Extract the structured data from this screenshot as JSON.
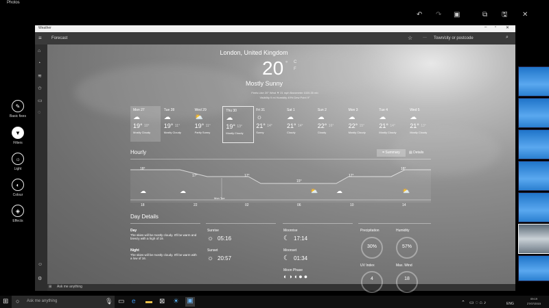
{
  "photos_app": {
    "title": "Photos",
    "tools": [
      {
        "label": "Basic fixes",
        "icon": "wand-icon"
      },
      {
        "label": "Filters",
        "icon": "filter-icon",
        "selected": true
      },
      {
        "label": "Light",
        "icon": "sun-icon"
      },
      {
        "label": "Colour",
        "icon": "palette-icon"
      },
      {
        "label": "Effects",
        "icon": "effects-icon"
      }
    ]
  },
  "weather_app": {
    "window_title": "Weather",
    "header_title": "Forecast",
    "search_placeholder": "Town/city or postcode",
    "location": "London, United Kingdom",
    "temperature": "20",
    "degree_symbol": "°",
    "unit_c": "C",
    "unit_f": "F",
    "condition": "Mostly Sunny",
    "details_line1": "Feels Like  20°    Wind  ▼ 21 mph    Barometer  1020.35 mb",
    "details_line2": "Visibility  9 mi    Humidity  49%    Dew Point  9°",
    "days": [
      {
        "name": "Mon 27",
        "hi": "19°",
        "lo": "10°",
        "cond": "Mostly Cloudy",
        "icon": "cloud-icon"
      },
      {
        "name": "Tue 28",
        "hi": "19°",
        "lo": "11°",
        "cond": "Mostly Cloudy",
        "icon": "cloud-icon"
      },
      {
        "name": "Wed 29",
        "hi": "19°",
        "lo": "11°",
        "cond": "Partly Sunny",
        "icon": "partly-sunny-icon"
      },
      {
        "name": "Thu 30",
        "hi": "19°",
        "lo": "13°",
        "cond": "Mostly Cloudy",
        "icon": "cloud-icon"
      },
      {
        "name": "Fri 31",
        "hi": "21°",
        "lo": "14°",
        "cond": "Sunny",
        "icon": "sun-icon"
      },
      {
        "name": "Sat 1",
        "hi": "21°",
        "lo": "14°",
        "cond": "Cloudy",
        "icon": "cloud-icon"
      },
      {
        "name": "Sun 2",
        "hi": "22°",
        "lo": "16°",
        "cond": "Cloudy",
        "icon": "cloud-icon"
      },
      {
        "name": "Mon 3",
        "hi": "22°",
        "lo": "15°",
        "cond": "Mostly Cloudy",
        "icon": "cloud-icon"
      },
      {
        "name": "Tue 4",
        "hi": "21°",
        "lo": "14°",
        "cond": "Mostly Cloudy",
        "icon": "cloud-icon"
      },
      {
        "name": "Wed 5",
        "hi": "21°",
        "lo": "13°",
        "cond": "Mostly Cloudy",
        "icon": "cloud-icon"
      }
    ],
    "hourly": {
      "title": "Hourly",
      "summary_label": "Summary",
      "details_label": "Details",
      "temps": [
        "18°",
        "17°",
        "17°",
        "15°",
        "17°",
        "18°"
      ],
      "times": [
        "18",
        "22",
        "02",
        "06",
        "10",
        "14"
      ],
      "divider_label": "Mon  Tue"
    },
    "day_details": {
      "title": "Day Details",
      "day_label": "Day",
      "day_text": "The skies will be mostly cloudy. It'll be warm and breezy with a high of 19.",
      "night_label": "Night",
      "night_text": "The skies will be mostly cloudy. It'll be warm with a low of 16.",
      "sunrise_label": "Sunrise",
      "sunrise": "05:16",
      "sunset_label": "Sunset",
      "sunset": "20:57",
      "moonrise_label": "Moonrise",
      "moonrise": "17:14",
      "moonset_label": "Moonset",
      "moonset": "01:34",
      "moonphase_label": "Moon Phase",
      "precip_label": "Precipitation",
      "precip": "30%",
      "precip_frac": 0.3,
      "humidity_label": "Humidity",
      "humidity": "57%",
      "humidity_frac": 0.57,
      "uv_label": "UV Index",
      "uv": "4",
      "wind_label": "Max. Wind",
      "wind": "18"
    },
    "inner_taskbar_search": "Ask me anything"
  },
  "taskbar": {
    "search_placeholder": "Ask me anything",
    "clock_time": "09:19",
    "clock_date": "27/07/2015",
    "language": "ENG"
  }
}
